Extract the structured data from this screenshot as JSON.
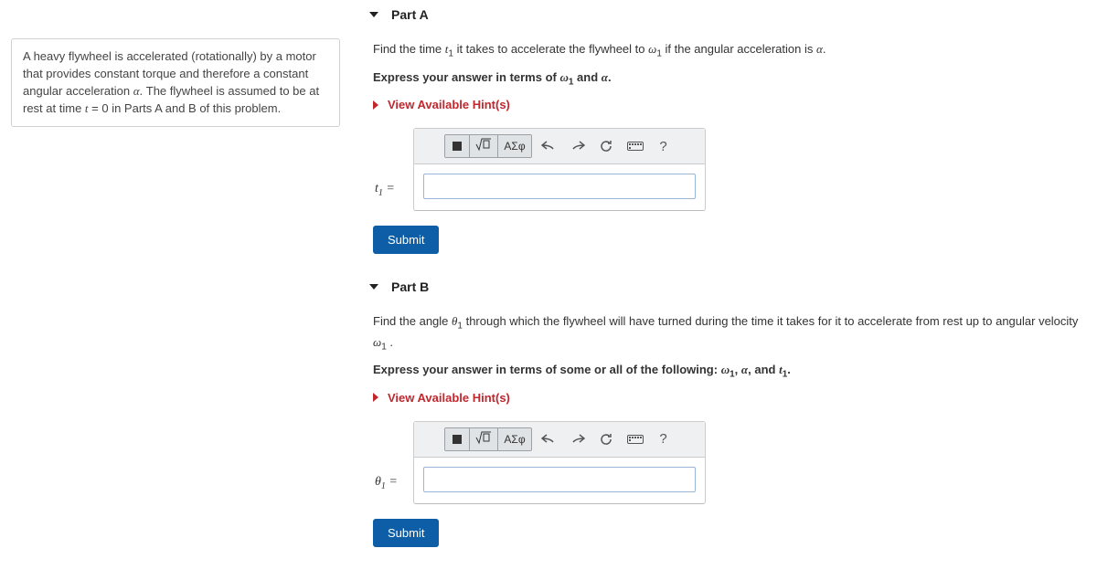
{
  "problem_statement": "A heavy flywheel is accelerated (rotationally) by a motor that provides constant torque and therefore a constant angular acceleration α. The flywheel is assumed to be at rest at time t = 0 in Parts A and B of this problem.",
  "toolbar": {
    "templates_tooltip": "Templates",
    "symbols_label": "ΑΣφ",
    "undo_tooltip": "Undo",
    "redo_tooltip": "Redo",
    "reset_tooltip": "Reset",
    "keyboard_tooltip": "Keyboard",
    "help_label": "?"
  },
  "hints_label": "View Available Hint(s)",
  "submit_label": "Submit",
  "partA": {
    "title": "Part A",
    "prompt_pre": "Find the time ",
    "prompt_var": "t",
    "prompt_sub": "1",
    "prompt_mid": " it takes to accelerate the flywheel to ",
    "prompt_var2": "ω",
    "prompt_sub2": "1",
    "prompt_post": " if the angular acceleration is ",
    "prompt_var3": "α",
    "prompt_end": ".",
    "express_pre": "Express your answer in terms of ",
    "express_v1": "ω",
    "express_s1": "1",
    "express_and": " and ",
    "express_v2": "α",
    "express_end": ".",
    "lhs_var": "t",
    "lhs_sub": "1",
    "lhs_eq": " ="
  },
  "partB": {
    "title": "Part B",
    "prompt_pre": "Find the angle ",
    "prompt_var": "θ",
    "prompt_sub": "1",
    "prompt_mid": " through which the flywheel will have turned during the time it takes for it to accelerate from rest up to angular velocity ",
    "prompt_var2": "ω",
    "prompt_sub2": "1",
    "prompt_end": " .",
    "express_pre": "Express your answer in terms of some or all of the following: ",
    "express_v1": "ω",
    "express_s1": "1",
    "express_c1": ", ",
    "express_v2": "α",
    "express_c2": ", and ",
    "express_v3": "t",
    "express_s3": "1",
    "express_end": ".",
    "lhs_var": "θ",
    "lhs_sub": "1",
    "lhs_eq": " ="
  }
}
